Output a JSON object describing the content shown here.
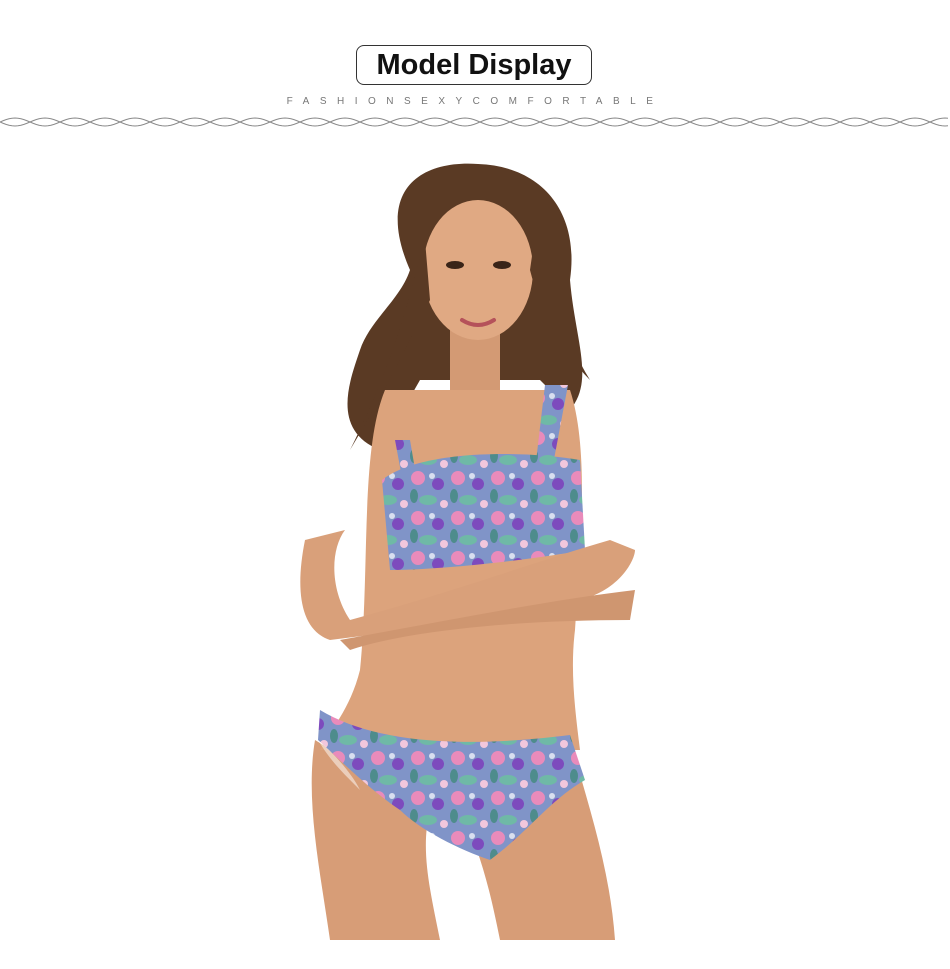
{
  "header": {
    "title": "Model Display",
    "tagline": "FASHIONSEXYCOMFORTABLE"
  },
  "colors": {
    "background": "#ffffff",
    "title_border": "#333333",
    "tagline": "#777777",
    "skin": "#d9a07a",
    "hair": "#5a3a24",
    "print_base": "#7f8fc4",
    "print_pink": "#e98bbb",
    "print_purple": "#7d4bbd",
    "print_teal": "#6fb9a6"
  },
  "photo": {
    "subject": "model-photo",
    "icon": "model-photo-illustration"
  }
}
